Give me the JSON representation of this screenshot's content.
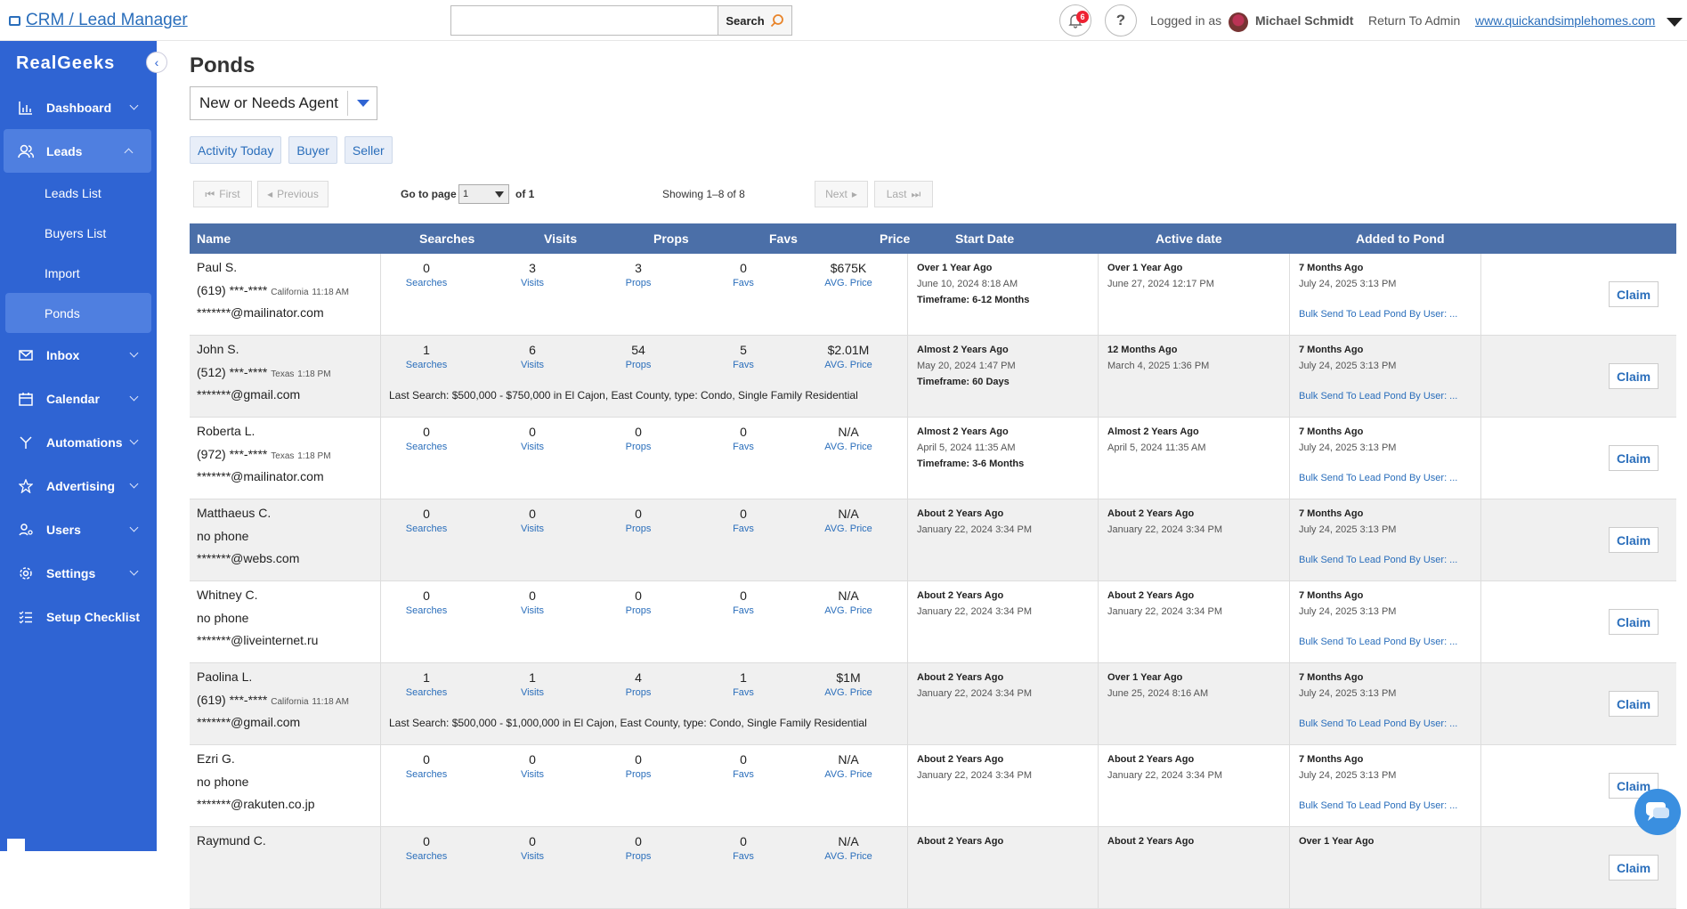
{
  "topbar": {
    "breadcrumb": "CRM / Lead Manager",
    "search_placeholder": "",
    "search_label": "Search",
    "notifications_count": "6",
    "logged_in_label": "Logged in as",
    "user_name": "Michael Schmidt",
    "return_label": "Return To Admin",
    "site_link": "www.quickandsimplehomes.com"
  },
  "sidebar": {
    "brand": "RealGeeks",
    "items": [
      {
        "label": "Dashboard",
        "icon": "chart-icon"
      },
      {
        "label": "Leads",
        "icon": "users-icon"
      },
      {
        "label": "Inbox",
        "icon": "mail-icon"
      },
      {
        "label": "Calendar",
        "icon": "calendar-icon"
      },
      {
        "label": "Automations",
        "icon": "branch-icon"
      },
      {
        "label": "Advertising",
        "icon": "star-icon"
      },
      {
        "label": "Users",
        "icon": "user-gear-icon"
      },
      {
        "label": "Settings",
        "icon": "gear-icon"
      },
      {
        "label": "Setup Checklist",
        "icon": "checklist-icon"
      }
    ],
    "leads_sub": [
      "Leads List",
      "Buyers List",
      "Import",
      "Ponds"
    ]
  },
  "main": {
    "title": "Ponds",
    "pond_select": "New or Needs Agent",
    "filters": [
      "Activity Today",
      "Buyer",
      "Seller"
    ],
    "pager": {
      "first": "First",
      "previous": "Previous",
      "next": "Next",
      "last": "Last",
      "goto_label": "Go to page",
      "page_value": "1",
      "of_label": "of 1",
      "showing": "Showing 1–8 of 8"
    },
    "columns": [
      "Name",
      "Searches",
      "Visits",
      "Props",
      "Favs",
      "Price",
      "Start Date",
      "Active date",
      "Added to Pond"
    ],
    "stat_labels": {
      "searches": "Searches",
      "visits": "Visits",
      "props": "Props",
      "favs": "Favs",
      "price": "AVG. Price"
    },
    "claim_label": "Claim",
    "rows": [
      {
        "name": "Paul S.",
        "phone": "(619) ***-****",
        "region": "California",
        "time": "11:18 AM",
        "email": "*******@mailinator.com",
        "searches": "0",
        "visits": "3",
        "props": "3",
        "favs": "0",
        "price": "$675K",
        "last_search": "",
        "start_rel": "Over 1 Year Ago",
        "start_date": "June 10, 2024 8:18 AM",
        "timeframe": "Timeframe: 6-12 Months",
        "active_rel": "Over 1 Year Ago",
        "active_date": "June 27, 2024 12:17 PM",
        "added_rel": "7 Months Ago",
        "added_date": "July 24, 2025 3:13 PM",
        "bulk": "Bulk Send To Lead Pond By User: ..."
      },
      {
        "name": "John S.",
        "phone": "(512) ***-****",
        "region": "Texas",
        "time": "1:18 PM",
        "email": "*******@gmail.com",
        "searches": "1",
        "visits": "6",
        "props": "54",
        "favs": "5",
        "price": "$2.01M",
        "last_search": "Last Search: $500,000 - $750,000 in El Cajon, East County, type: Condo, Single Family Residential",
        "start_rel": "Almost 2 Years Ago",
        "start_date": "May 20, 2024 1:47 PM",
        "timeframe": "Timeframe: 60 Days",
        "active_rel": "12 Months Ago",
        "active_date": "March 4, 2025 1:36 PM",
        "added_rel": "7 Months Ago",
        "added_date": "July 24, 2025 3:13 PM",
        "bulk": "Bulk Send To Lead Pond By User: ..."
      },
      {
        "name": "Roberta L.",
        "phone": "(972) ***-****",
        "region": "Texas",
        "time": "1:18 PM",
        "email": "*******@mailinator.com",
        "searches": "0",
        "visits": "0",
        "props": "0",
        "favs": "0",
        "price": "N/A",
        "last_search": "",
        "start_rel": "Almost 2 Years Ago",
        "start_date": "April 5, 2024 11:35 AM",
        "timeframe": "Timeframe: 3-6 Months",
        "active_rel": "Almost 2 Years Ago",
        "active_date": "April 5, 2024 11:35 AM",
        "added_rel": "7 Months Ago",
        "added_date": "July 24, 2025 3:13 PM",
        "bulk": "Bulk Send To Lead Pond By User: ..."
      },
      {
        "name": "Matthaeus C.",
        "phone": "no phone",
        "region": "",
        "time": "",
        "email": "*******@webs.com",
        "searches": "0",
        "visits": "0",
        "props": "0",
        "favs": "0",
        "price": "N/A",
        "last_search": "",
        "start_rel": "About 2 Years Ago",
        "start_date": "January 22, 2024 3:34 PM",
        "timeframe": "",
        "active_rel": "About 2 Years Ago",
        "active_date": "January 22, 2024 3:34 PM",
        "added_rel": "7 Months Ago",
        "added_date": "July 24, 2025 3:13 PM",
        "bulk": "Bulk Send To Lead Pond By User: ..."
      },
      {
        "name": "Whitney C.",
        "phone": "no phone",
        "region": "",
        "time": "",
        "email": "*******@liveinternet.ru",
        "searches": "0",
        "visits": "0",
        "props": "0",
        "favs": "0",
        "price": "N/A",
        "last_search": "",
        "start_rel": "About 2 Years Ago",
        "start_date": "January 22, 2024 3:34 PM",
        "timeframe": "",
        "active_rel": "About 2 Years Ago",
        "active_date": "January 22, 2024 3:34 PM",
        "added_rel": "7 Months Ago",
        "added_date": "July 24, 2025 3:13 PM",
        "bulk": "Bulk Send To Lead Pond By User: ..."
      },
      {
        "name": "Paolina L.",
        "phone": "(619) ***-****",
        "region": "California",
        "time": "11:18 AM",
        "email": "*******@gmail.com",
        "searches": "1",
        "visits": "1",
        "props": "4",
        "favs": "1",
        "price": "$1M",
        "last_search": "Last Search: $500,000 - $1,000,000 in El Cajon, East County, type: Condo, Single Family Residential",
        "start_rel": "About 2 Years Ago",
        "start_date": "January 22, 2024 3:34 PM",
        "timeframe": "",
        "active_rel": "Over 1 Year Ago",
        "active_date": "June 25, 2024 8:16 AM",
        "added_rel": "7 Months Ago",
        "added_date": "July 24, 2025 3:13 PM",
        "bulk": "Bulk Send To Lead Pond By User: ..."
      },
      {
        "name": "Ezri G.",
        "phone": "no phone",
        "region": "",
        "time": "",
        "email": "*******@rakuten.co.jp",
        "searches": "0",
        "visits": "0",
        "props": "0",
        "favs": "0",
        "price": "N/A",
        "last_search": "",
        "start_rel": "About 2 Years Ago",
        "start_date": "January 22, 2024 3:34 PM",
        "timeframe": "",
        "active_rel": "About 2 Years Ago",
        "active_date": "January 22, 2024 3:34 PM",
        "added_rel": "7 Months Ago",
        "added_date": "July 24, 2025 3:13 PM",
        "bulk": "Bulk Send To Lead Pond By User: ..."
      },
      {
        "name": "Raymund C.",
        "phone": "",
        "region": "",
        "time": "",
        "email": "",
        "searches": "0",
        "visits": "0",
        "props": "0",
        "favs": "0",
        "price": "N/A",
        "last_search": "",
        "start_rel": "About 2 Years Ago",
        "start_date": "",
        "timeframe": "",
        "active_rel": "About 2 Years Ago",
        "active_date": "",
        "added_rel": "Over 1 Year Ago",
        "added_date": "",
        "bulk": ""
      }
    ]
  }
}
